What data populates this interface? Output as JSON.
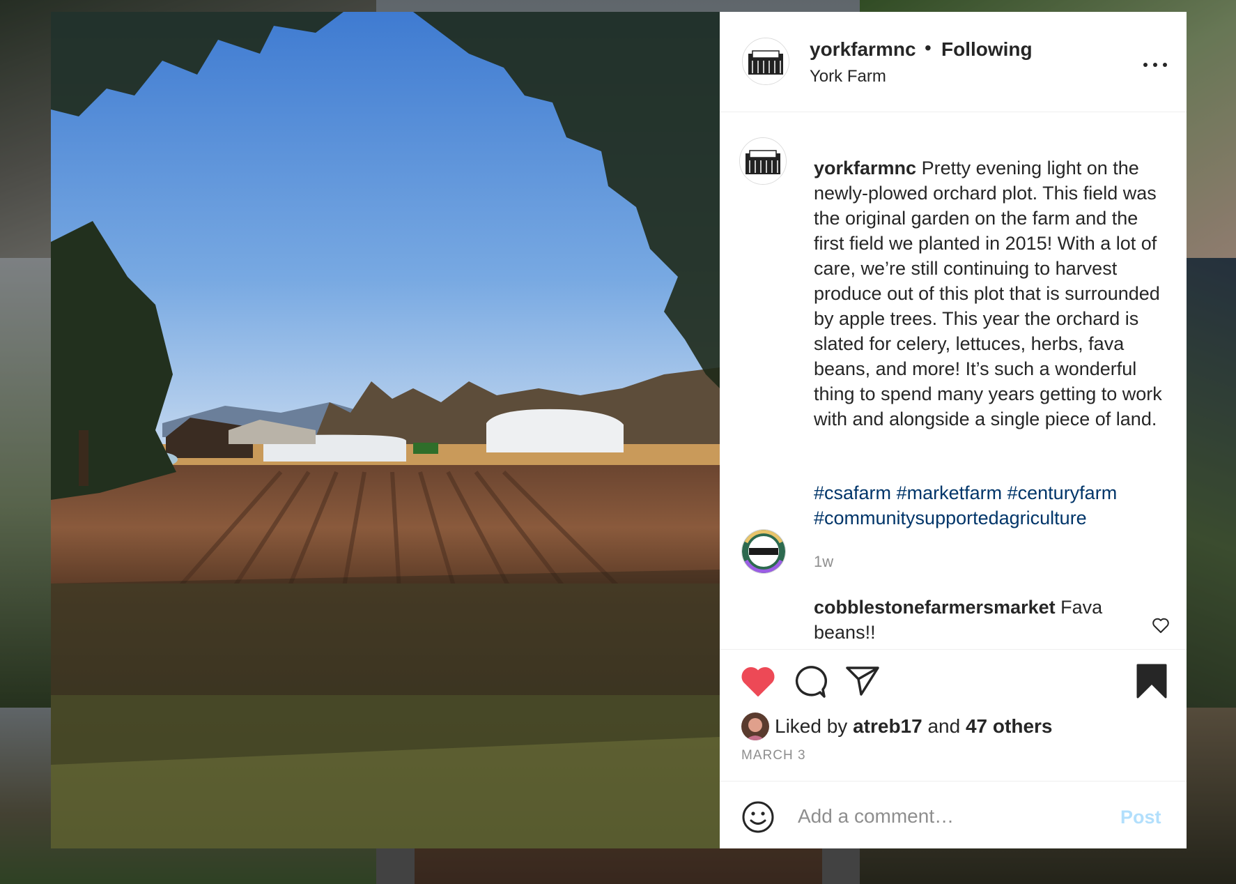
{
  "post": {
    "username": "yorkfarmnc",
    "separator": "•",
    "follow_status": "Following",
    "location": "York Farm",
    "caption_text": " Pretty evening light on the newly-plowed orchard plot. This field was the original garden on the farm and the first field we planted in 2015! With a lot of care, we’re still continuing to harvest produce out of this plot that is surrounded by apple trees. This year the orchard is slated for celery, lettuces, herbs, fava beans, and more! It’s such a wonderful thing to spend many years getting to work with and alongside a single piece of land.",
    "hashtags": [
      "#csafarm",
      "#marketfarm",
      "#centuryfarm",
      "#communitysupportedagriculture"
    ],
    "age": "1w",
    "comments": [
      {
        "username": "cobblestonefarmersmarket",
        "text": " Fava beans!!"
      }
    ],
    "liked": true,
    "saved": true,
    "likes": {
      "prefix": "Liked by ",
      "first_user": "atreb17",
      "middle": " and ",
      "others": "47 others"
    },
    "date": "MARCH 3"
  },
  "comment_box": {
    "placeholder": "Add a comment…",
    "post_label": "Post"
  },
  "icons": {
    "more": "more-options-icon",
    "like": "heart-filled-icon",
    "comment": "comment-bubble-icon",
    "share": "paper-plane-icon",
    "save": "bookmark-filled-icon",
    "emoji": "smiley-icon",
    "comment_like": "heart-outline-icon"
  },
  "colors": {
    "like_red": "#ed4956",
    "hashtag_blue": "#003569",
    "post_disabled": "#b2dffc",
    "muted_text": "#8e8e8e"
  }
}
